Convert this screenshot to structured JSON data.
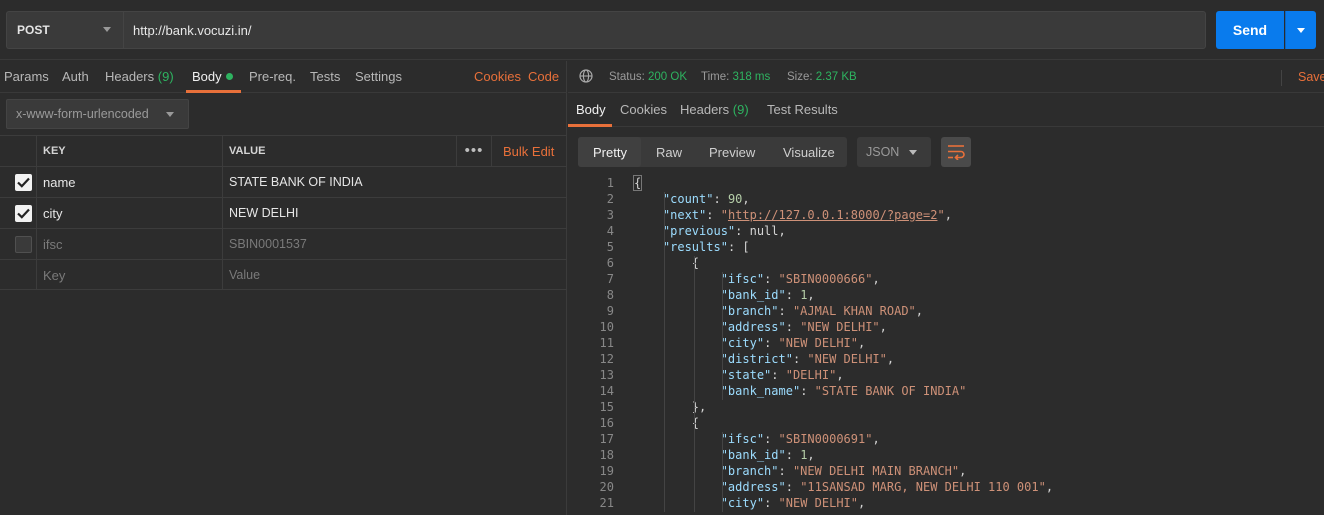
{
  "request": {
    "method": "POST",
    "url": "http://bank.vocuzi.in/",
    "send_label": "Send"
  },
  "left_tabs": {
    "params": "Params",
    "auth": "Auth",
    "headers": "Headers",
    "headers_count": "(9)",
    "body": "Body",
    "prereq": "Pre-req.",
    "tests": "Tests",
    "settings": "Settings",
    "cookies": "Cookies",
    "code": "Code"
  },
  "body_type": "x-www-form-urlencoded",
  "params_table": {
    "key_header": "KEY",
    "value_header": "VALUE",
    "more": "•••",
    "bulk_edit": "Bulk Edit",
    "rows": [
      {
        "key": "name",
        "value": "STATE BANK OF INDIA",
        "checked": true
      },
      {
        "key": "city",
        "value": "NEW DELHI",
        "checked": true
      },
      {
        "key": "ifsc",
        "value": "SBIN0001537",
        "checked": false
      }
    ],
    "placeholder_key": "Key",
    "placeholder_value": "Value"
  },
  "response_status": {
    "status_label": "Status:",
    "status_value": "200 OK",
    "time_label": "Time:",
    "time_value": "318 ms",
    "size_label": "Size:",
    "size_value": "2.37 KB",
    "save": "Save"
  },
  "response_tabs": {
    "body": "Body",
    "cookies": "Cookies",
    "headers": "Headers",
    "headers_count": "(9)",
    "test_results": "Test Results"
  },
  "view_modes": {
    "pretty": "Pretty",
    "raw": "Raw",
    "preview": "Preview",
    "visualize": "Visualize",
    "format": "JSON"
  },
  "colors": {
    "accent": "#e8703a",
    "send_blue": "#097bed",
    "status_green": "#2eb360"
  },
  "code_lines": [
    "{",
    "    \"count\": 90,",
    "    \"next\": \"http://127.0.0.1:8000/?page=2\",",
    "    \"previous\": null,",
    "    \"results\": [",
    "        {",
    "            \"ifsc\": \"SBIN0000666\",",
    "            \"bank_id\": 1,",
    "            \"branch\": \"AJMAL KHAN ROAD\",",
    "            \"address\": \"NEW DELHI\",",
    "            \"city\": \"NEW DELHI\",",
    "            \"district\": \"NEW DELHI\",",
    "            \"state\": \"DELHI\",",
    "            \"bank_name\": \"STATE BANK OF INDIA\"",
    "        },",
    "        {",
    "            \"ifsc\": \"SBIN0000691\",",
    "            \"bank_id\": 1,",
    "            \"branch\": \"NEW DELHI MAIN BRANCH\",",
    "            \"address\": \"11SANSAD MARG, NEW DELHI 110 001\",",
    "            \"city\": \"NEW DELHI\","
  ]
}
